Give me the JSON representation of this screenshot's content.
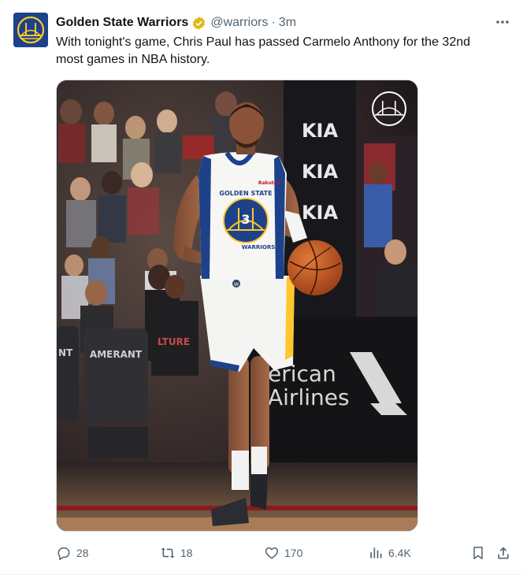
{
  "account": {
    "name": "Golden State Warriors",
    "handle": "@warriors",
    "separator": "·",
    "time": "3m"
  },
  "tweet": {
    "text": "With tonight's game, Chris Paul has passed Carmelo Anthony for the 32nd most games in NBA history."
  },
  "media": {
    "signage": {
      "kia": "KIA",
      "airline_line1": "erican",
      "airline_line2": "Airlines",
      "chair_brand": "AMERANT",
      "chair_left": "NT",
      "fan_shirt": "LTURE"
    },
    "jersey": {
      "team": "GOLDEN STATE",
      "team_bottom": "WARRIORS",
      "number": "3",
      "sponsor": "Rakuten",
      "short_logo": "W"
    }
  },
  "actions": {
    "replies": "28",
    "reposts": "18",
    "likes": "170",
    "views": "6.4K"
  },
  "colors": {
    "warriors_blue": "#1d428a",
    "warriors_gold": "#ffc72c",
    "verified_gold": "#e2b719",
    "meta_gray": "#536471"
  },
  "icons": [
    "more-icon",
    "reply-icon",
    "repost-icon",
    "like-icon",
    "views-icon",
    "bookmark-icon",
    "share-icon",
    "verified-badge-icon",
    "warriors-watermark-icon"
  ]
}
